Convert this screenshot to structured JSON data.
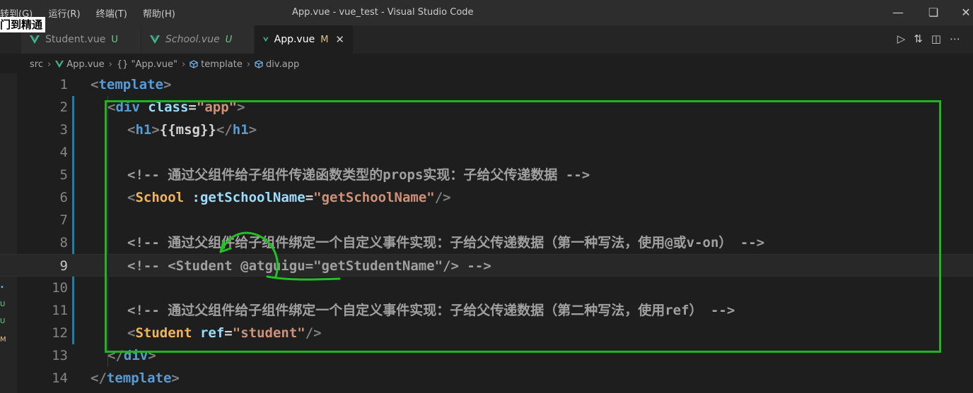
{
  "menu": [
    "转到(G)",
    "运行(R)",
    "终端(T)",
    "帮助(H)"
  ],
  "window_title": "App.vue - vue_test - Visual Studio Code",
  "watermark": "门到精通",
  "tabs": [
    {
      "label": "Student.vue",
      "badge": "U"
    },
    {
      "label": "School.vue",
      "badge": "U"
    },
    {
      "label": "App.vue",
      "badge": "M",
      "close": "✕"
    }
  ],
  "breadcrumb": {
    "src": "src",
    "file": "App.vue",
    "symbol": "{} \"App.vue\"",
    "template": "template",
    "div": "div.app"
  },
  "lines": [
    {
      "n": "1"
    },
    {
      "n": "2"
    },
    {
      "n": "3"
    },
    {
      "n": "4"
    },
    {
      "n": "5"
    },
    {
      "n": "6"
    },
    {
      "n": "7"
    },
    {
      "n": "8"
    },
    {
      "n": "9"
    },
    {
      "n": "10"
    },
    {
      "n": "11"
    },
    {
      "n": "12"
    },
    {
      "n": "13"
    },
    {
      "n": "14"
    }
  ],
  "code": {
    "l1": {
      "open": "<",
      "tag": "template",
      "close": ">"
    },
    "l2": {
      "open": "<",
      "tag": "div",
      "attr": " class",
      "eq": "=",
      "val": "\"app\"",
      "close": ">"
    },
    "l3": {
      "open": "<",
      "tag": "h1",
      "close": ">",
      "text": "{{msg}}",
      "endopen": "</",
      "endtag": "h1",
      "endclose": ">"
    },
    "l5": "<!-- 通过父组件给子组件传递函数类型的props实现：子给父传递数据 -->",
    "l6": {
      "open": "<",
      "tag": "School",
      "attr": " :getSchoolName",
      "eq": "=",
      "val": "\"getSchoolName\"",
      "close": "/>"
    },
    "l8": "<!-- 通过父组件给子组件绑定一个自定义事件实现：子给父传递数据（第一种写法，使用@或v-on） -->",
    "l9": "<!-- <Student @atguigu=\"getStudentName\"/> -->",
    "l11": "<!-- 通过父组件给子组件绑定一个自定义事件实现：子给父传递数据（第二种写法，使用ref） -->",
    "l12": {
      "open": "<",
      "tag": "Student",
      "attr": " ref",
      "eq": "=",
      "val": "\"student\"",
      "close": "/>"
    },
    "l13": {
      "open": "</",
      "tag": "div",
      "close": ">"
    },
    "l14": {
      "open": "</",
      "tag": "template",
      "close": ">"
    }
  },
  "colors": {
    "highlight_box": "#1fb51f",
    "tag": "#569cd6",
    "attr": "#9cdcfe",
    "string": "#ce9178"
  }
}
